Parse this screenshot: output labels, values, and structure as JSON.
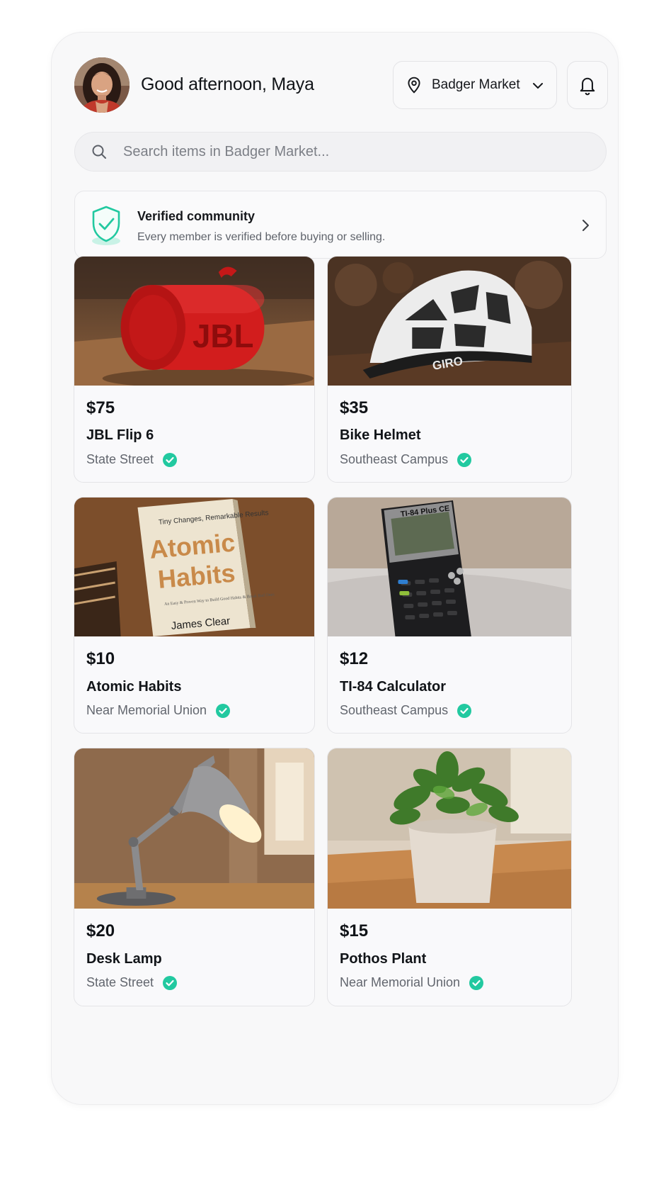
{
  "header": {
    "greeting": "Good afternoon, Maya",
    "market_label": "Badger Market"
  },
  "search": {
    "placeholder": "Search items in Badger Market..."
  },
  "verified": {
    "title": "Verified community",
    "subtitle": "Every member is verified before buying or selling."
  },
  "listings": [
    {
      "price": "$75",
      "title": "JBL Flip 6",
      "location": "State Street",
      "verified": true
    },
    {
      "price": "$35",
      "title": "Bike Helmet",
      "location": "Southeast Campus",
      "verified": true
    },
    {
      "price": "$10",
      "title": "Atomic Habits",
      "location": "Near Memorial Union",
      "verified": true
    },
    {
      "price": "$12",
      "title": "TI-84 Calculator",
      "location": "Southeast Campus",
      "verified": true
    },
    {
      "price": "$20",
      "title": "Desk Lamp",
      "location": "State Street",
      "verified": true
    },
    {
      "price": "$15",
      "title": "Pothos Plant",
      "location": "Near Memorial Union",
      "verified": true
    }
  ],
  "photo_text": {
    "speaker_brand": "JBL",
    "helmet_brand": "GIRO",
    "book_tagline": "Tiny Changes, Remarkable Results",
    "book_title_1": "Atomic",
    "book_title_2": "Habits",
    "book_blurb": "An Easy & Proven Way to Build Good Habits & Break Bad Ones",
    "book_author": "James Clear",
    "calc_model": "TI-84 Plus CE"
  },
  "colors": {
    "accent": "#22c9a0",
    "text": "#111418",
    "muted": "#62666e"
  }
}
